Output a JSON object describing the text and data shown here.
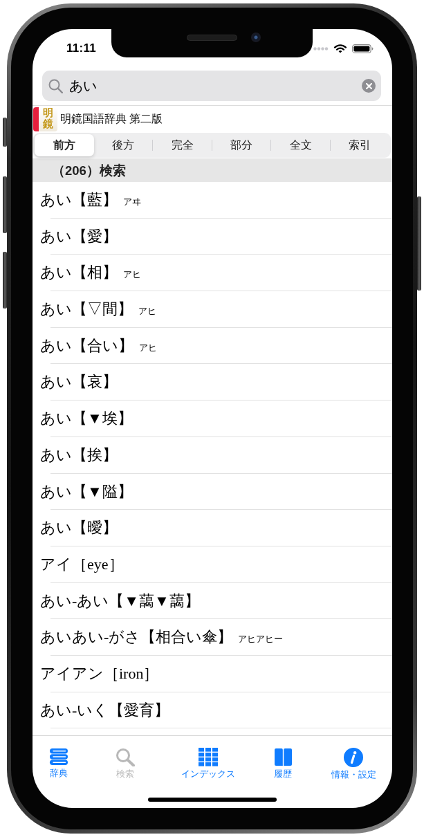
{
  "status_bar": {
    "time": "11:11"
  },
  "search": {
    "value": "あい"
  },
  "dictionary": {
    "logo": "明鏡",
    "title": "明鏡国語辞典 第二版"
  },
  "search_modes": [
    {
      "label": "前方",
      "selected": true
    },
    {
      "label": "後方",
      "selected": false
    },
    {
      "label": "完全",
      "selected": false
    },
    {
      "label": "部分",
      "selected": false
    },
    {
      "label": "全文",
      "selected": false
    },
    {
      "label": "索引",
      "selected": false
    }
  ],
  "results": {
    "header": "（206）検索",
    "rows": [
      {
        "headword": "あい【藍】",
        "reading": "アヰ"
      },
      {
        "headword": "あい【愛】"
      },
      {
        "headword": "あい【相】",
        "reading": "アヒ"
      },
      {
        "headword": "あい【▽間】",
        "reading": "アヒ"
      },
      {
        "headword": "あい【合い】",
        "reading": "アヒ"
      },
      {
        "headword": "あい【哀】"
      },
      {
        "headword": "あい【▼埃】"
      },
      {
        "headword": "あい【挨】"
      },
      {
        "headword": "あい【▼隘】"
      },
      {
        "headword": "あい【曖】"
      },
      {
        "headword": "アイ［eye］"
      },
      {
        "headword": "あい‐あい【▼藹▼藹】"
      },
      {
        "headword": "あいあい‐がさ【相合い傘】",
        "reading": "アヒアヒー"
      },
      {
        "headword": "アイアン［iron］"
      },
      {
        "headword": "あい‐いく【愛育】"
      }
    ]
  },
  "tab_bar": [
    {
      "kind": "dictionary",
      "label": "辞典",
      "selected": false
    },
    {
      "kind": "search",
      "label": "検索",
      "selected": true
    },
    {
      "kind": "index",
      "label": "インデックス",
      "selected": false
    },
    {
      "kind": "history",
      "label": "履歴",
      "selected": false
    },
    {
      "kind": "info",
      "label": "情報・設定",
      "selected": false
    }
  ]
}
